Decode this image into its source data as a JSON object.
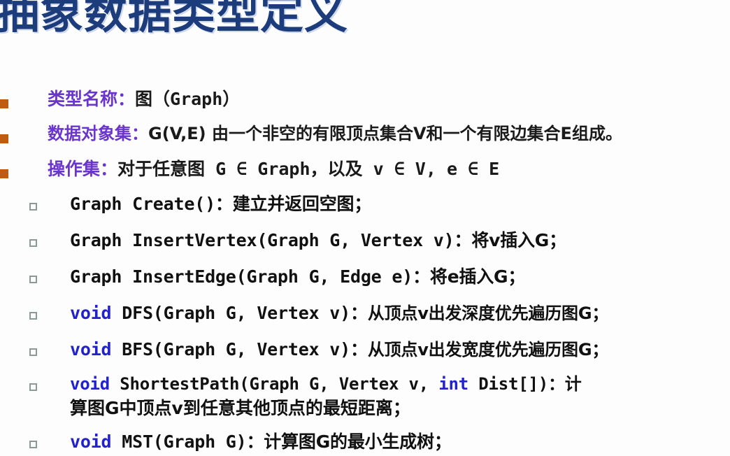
{
  "slide": {
    "title": "抽象数据类型定义",
    "title_color": "#1c3c7c",
    "bullet_color": "#c05c12",
    "label_color": "#6a35cc",
    "keyword_color": "#2222cc",
    "background": "#fdfdfd"
  },
  "level1": [
    {
      "bullet": "square-bullet",
      "label": "类型名称：",
      "value": "图（Graph）"
    },
    {
      "bullet": "square-bullet",
      "label": "数据对象集：",
      "value": "G(V,E) 由一个非空的有限顶点集合V和一个有限边集合E组成。"
    },
    {
      "bullet": "square-bullet",
      "label": "操作集：",
      "value": "对于任意图 G ∈ Graph，以及 v ∈ V, e ∈ E"
    }
  ],
  "operations": [
    {
      "bullet": "hollow-square-bullet",
      "keyword": "",
      "signature": "Graph Create()",
      "separator": "：",
      "description": "建立并返回空图；",
      "continuation": ""
    },
    {
      "bullet": "hollow-square-bullet",
      "keyword": "",
      "signature": "Graph InsertVertex(Graph G, Vertex v)",
      "separator": "：",
      "description": "将v插入G；",
      "continuation": ""
    },
    {
      "bullet": "hollow-square-bullet",
      "keyword": "",
      "signature": "Graph InsertEdge(Graph G, Edge e)",
      "separator": "：",
      "description": "将e插入G；",
      "continuation": ""
    },
    {
      "bullet": "hollow-square-bullet",
      "keyword": "void",
      "signature": " DFS(Graph G, Vertex v)",
      "separator": "：",
      "description": "从顶点v出发深度优先遍历图G；",
      "continuation": ""
    },
    {
      "bullet": "hollow-square-bullet",
      "keyword": "void",
      "signature": " BFS(Graph G, Vertex v)",
      "separator": "：",
      "description": "从顶点v出发宽度优先遍历图G；",
      "continuation": ""
    },
    {
      "bullet": "hollow-square-bullet",
      "keyword": "void",
      "signature": " ShortestPath(Graph G, Vertex v, ",
      "keyword2": "int",
      "signature2": " Dist[])",
      "separator": "：",
      "description": "计",
      "continuation": "算图G中顶点v到任意其他顶点的最短距离；"
    },
    {
      "bullet": "hollow-square-bullet",
      "keyword": "void",
      "signature": " MST(Graph G)",
      "separator": "：",
      "description": "计算图G的最小生成树；",
      "continuation": ""
    }
  ]
}
